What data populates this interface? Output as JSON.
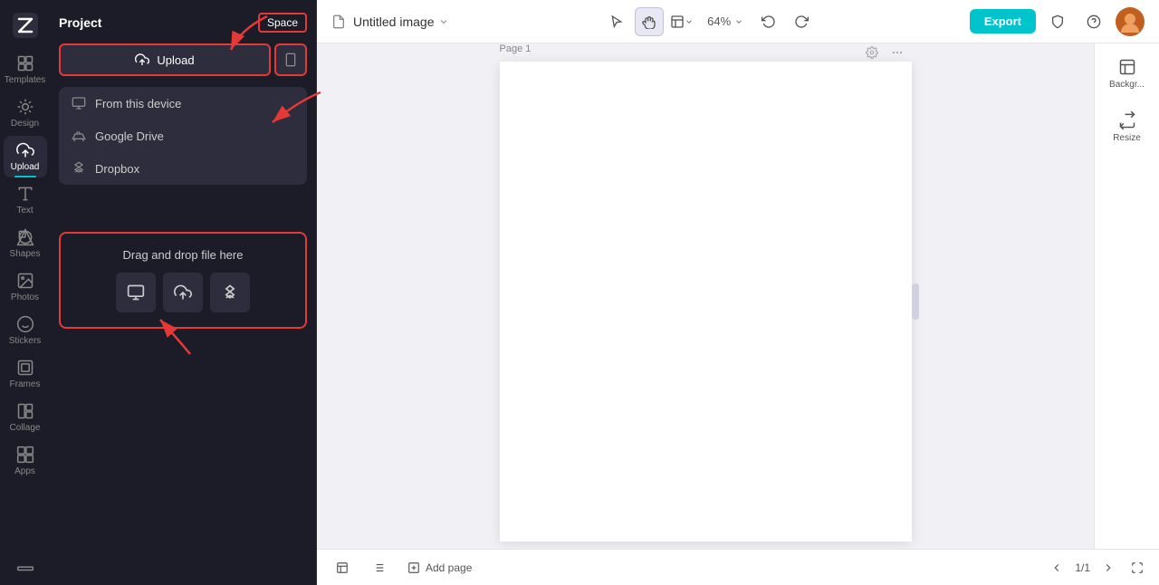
{
  "app": {
    "logo_icon": "Z",
    "project_label": "Project",
    "space_label": "Space"
  },
  "sidebar": {
    "items": [
      {
        "id": "templates",
        "label": "Templates",
        "icon": "grid"
      },
      {
        "id": "design",
        "label": "Design",
        "icon": "design"
      },
      {
        "id": "upload",
        "label": "Upload",
        "icon": "upload"
      },
      {
        "id": "text",
        "label": "Text",
        "icon": "text"
      },
      {
        "id": "shapes",
        "label": "Shapes",
        "icon": "shapes"
      },
      {
        "id": "photos",
        "label": "Photos",
        "icon": "photos"
      },
      {
        "id": "stickers",
        "label": "Stickers",
        "icon": "stickers"
      },
      {
        "id": "frames",
        "label": "Frames",
        "icon": "frames"
      },
      {
        "id": "collage",
        "label": "Collage",
        "icon": "collage"
      },
      {
        "id": "apps",
        "label": "Apps",
        "icon": "apps"
      }
    ]
  },
  "panel": {
    "upload_button_label": "Upload",
    "from_device_label": "From this device",
    "google_drive_label": "Google Drive",
    "dropbox_label": "Dropbox",
    "drag_drop_label": "Drag and drop file here"
  },
  "header": {
    "doc_title": "Untitled image",
    "zoom_level": "64%",
    "export_label": "Export",
    "page_label": "Page 1",
    "add_page_label": "Add page",
    "page_nav": "1/1"
  },
  "right_panel": {
    "background_label": "Backgr...",
    "resize_label": "Resize"
  },
  "colors": {
    "accent": "#00c4cc",
    "red": "#e53935",
    "sidebar_bg": "#1c1c28",
    "panel_bg": "#1c1c28",
    "main_bg": "#f0f0f5"
  }
}
